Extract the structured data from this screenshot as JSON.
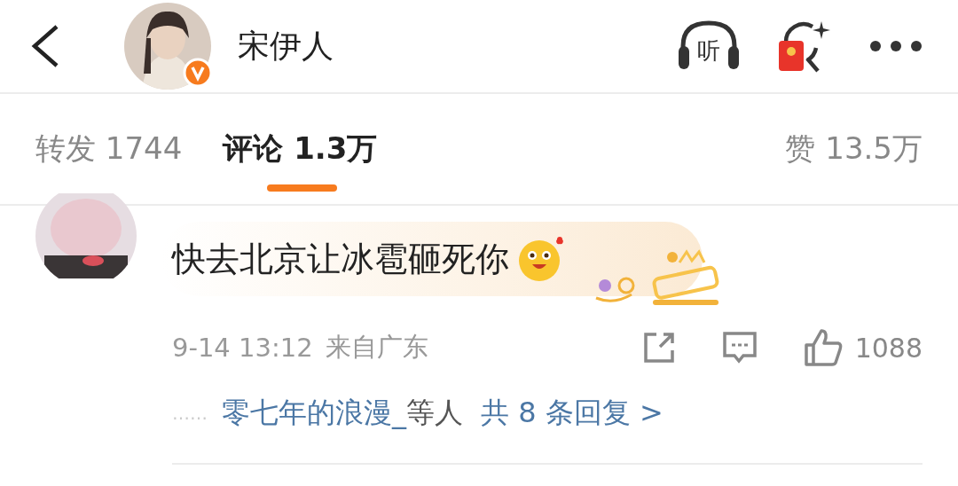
{
  "header": {
    "name": "宋伊人",
    "verified": true,
    "listen_label": "听"
  },
  "tabs": [
    {
      "label": "转发",
      "count": "1744",
      "selected": false
    },
    {
      "label": "评论",
      "count": "1.3万",
      "selected": true
    },
    {
      "label": "赞",
      "count": "13.5万",
      "selected": false
    }
  ],
  "comment": {
    "text": "快去北京让冰雹砸死你",
    "time": "9-14 13:12",
    "location": "来自广东",
    "likes": "1088",
    "replies": {
      "dots": "……",
      "names": "零七年的浪漫_",
      "suffix": "等人",
      "total": "共 8 条回复 >"
    }
  }
}
